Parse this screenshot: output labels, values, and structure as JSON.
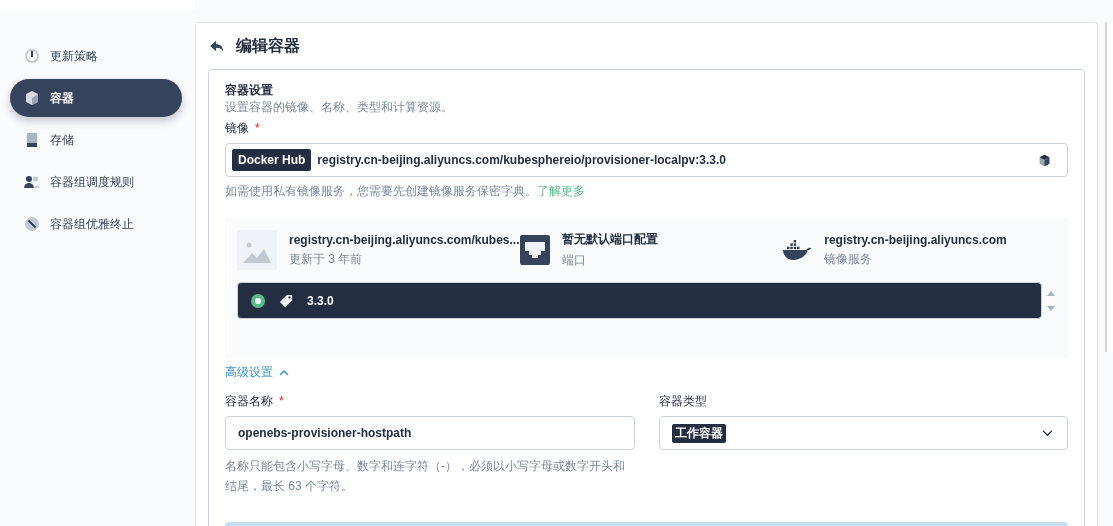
{
  "sidebar": {
    "items": [
      {
        "label": "更新策略",
        "selected": false
      },
      {
        "label": "容器",
        "selected": true
      },
      {
        "label": "存储",
        "selected": false
      },
      {
        "label": "容器组调度规则",
        "selected": false
      },
      {
        "label": "容器组优雅终止",
        "selected": false
      }
    ]
  },
  "page_title": "编辑容器",
  "section": {
    "title": "容器设置",
    "description": "设置容器的镜像、名称、类型和计算资源。"
  },
  "image": {
    "label": "镜像",
    "required_mark": "*",
    "registry_tag": "Docker Hub",
    "value": "registry.cn-beijing.aliyuncs.com/kubesphereio/provisioner-localpv:3.3.0",
    "hint": "如需使用私有镜像服务，您需要先创建镜像服务保密字典。",
    "hint_link": "了解更多"
  },
  "image_info": [
    {
      "kind": "image",
      "title": "registry.cn-beijing.aliyuncs.com/kubes...",
      "subtitle": "更新于 3 年前"
    },
    {
      "kind": "port",
      "title": "暂无默认端口配置",
      "subtitle": "端口"
    },
    {
      "kind": "registry",
      "title": "registry.cn-beijing.aliyuncs.com",
      "subtitle": "镜像服务"
    }
  ],
  "tags": [
    {
      "label": "3.3.0",
      "selected": true
    }
  ],
  "advanced": {
    "label": "高级设置",
    "expanded": true
  },
  "container_name": {
    "label": "容器名称",
    "required_mark": "*",
    "value": "openebs-provisioner-hostpath",
    "hint": "名称只能包含小写字母、数字和连字符（-），必须以小写字母或数字开头和结尾，最长 63 个字符。"
  },
  "container_type": {
    "label": "容器类型",
    "value": "工作容器"
  }
}
